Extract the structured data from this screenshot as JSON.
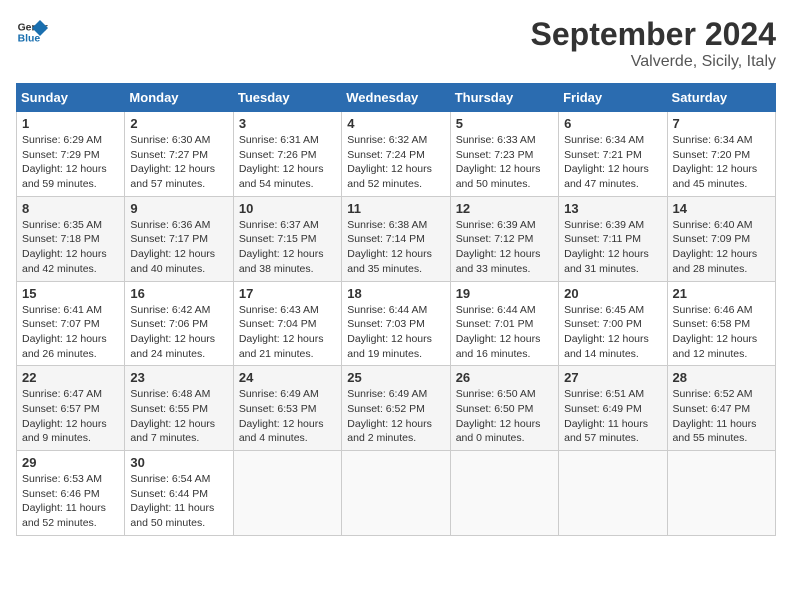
{
  "header": {
    "logo_line1": "General",
    "logo_line2": "Blue",
    "title": "September 2024",
    "subtitle": "Valverde, Sicily, Italy"
  },
  "weekdays": [
    "Sunday",
    "Monday",
    "Tuesday",
    "Wednesday",
    "Thursday",
    "Friday",
    "Saturday"
  ],
  "weeks": [
    [
      {
        "day": "1",
        "info": "Sunrise: 6:29 AM\nSunset: 7:29 PM\nDaylight: 12 hours\nand 59 minutes."
      },
      {
        "day": "2",
        "info": "Sunrise: 6:30 AM\nSunset: 7:27 PM\nDaylight: 12 hours\nand 57 minutes."
      },
      {
        "day": "3",
        "info": "Sunrise: 6:31 AM\nSunset: 7:26 PM\nDaylight: 12 hours\nand 54 minutes."
      },
      {
        "day": "4",
        "info": "Sunrise: 6:32 AM\nSunset: 7:24 PM\nDaylight: 12 hours\nand 52 minutes."
      },
      {
        "day": "5",
        "info": "Sunrise: 6:33 AM\nSunset: 7:23 PM\nDaylight: 12 hours\nand 50 minutes."
      },
      {
        "day": "6",
        "info": "Sunrise: 6:34 AM\nSunset: 7:21 PM\nDaylight: 12 hours\nand 47 minutes."
      },
      {
        "day": "7",
        "info": "Sunrise: 6:34 AM\nSunset: 7:20 PM\nDaylight: 12 hours\nand 45 minutes."
      }
    ],
    [
      {
        "day": "8",
        "info": "Sunrise: 6:35 AM\nSunset: 7:18 PM\nDaylight: 12 hours\nand 42 minutes."
      },
      {
        "day": "9",
        "info": "Sunrise: 6:36 AM\nSunset: 7:17 PM\nDaylight: 12 hours\nand 40 minutes."
      },
      {
        "day": "10",
        "info": "Sunrise: 6:37 AM\nSunset: 7:15 PM\nDaylight: 12 hours\nand 38 minutes."
      },
      {
        "day": "11",
        "info": "Sunrise: 6:38 AM\nSunset: 7:14 PM\nDaylight: 12 hours\nand 35 minutes."
      },
      {
        "day": "12",
        "info": "Sunrise: 6:39 AM\nSunset: 7:12 PM\nDaylight: 12 hours\nand 33 minutes."
      },
      {
        "day": "13",
        "info": "Sunrise: 6:39 AM\nSunset: 7:11 PM\nDaylight: 12 hours\nand 31 minutes."
      },
      {
        "day": "14",
        "info": "Sunrise: 6:40 AM\nSunset: 7:09 PM\nDaylight: 12 hours\nand 28 minutes."
      }
    ],
    [
      {
        "day": "15",
        "info": "Sunrise: 6:41 AM\nSunset: 7:07 PM\nDaylight: 12 hours\nand 26 minutes."
      },
      {
        "day": "16",
        "info": "Sunrise: 6:42 AM\nSunset: 7:06 PM\nDaylight: 12 hours\nand 24 minutes."
      },
      {
        "day": "17",
        "info": "Sunrise: 6:43 AM\nSunset: 7:04 PM\nDaylight: 12 hours\nand 21 minutes."
      },
      {
        "day": "18",
        "info": "Sunrise: 6:44 AM\nSunset: 7:03 PM\nDaylight: 12 hours\nand 19 minutes."
      },
      {
        "day": "19",
        "info": "Sunrise: 6:44 AM\nSunset: 7:01 PM\nDaylight: 12 hours\nand 16 minutes."
      },
      {
        "day": "20",
        "info": "Sunrise: 6:45 AM\nSunset: 7:00 PM\nDaylight: 12 hours\nand 14 minutes."
      },
      {
        "day": "21",
        "info": "Sunrise: 6:46 AM\nSunset: 6:58 PM\nDaylight: 12 hours\nand 12 minutes."
      }
    ],
    [
      {
        "day": "22",
        "info": "Sunrise: 6:47 AM\nSunset: 6:57 PM\nDaylight: 12 hours\nand 9 minutes."
      },
      {
        "day": "23",
        "info": "Sunrise: 6:48 AM\nSunset: 6:55 PM\nDaylight: 12 hours\nand 7 minutes."
      },
      {
        "day": "24",
        "info": "Sunrise: 6:49 AM\nSunset: 6:53 PM\nDaylight: 12 hours\nand 4 minutes."
      },
      {
        "day": "25",
        "info": "Sunrise: 6:49 AM\nSunset: 6:52 PM\nDaylight: 12 hours\nand 2 minutes."
      },
      {
        "day": "26",
        "info": "Sunrise: 6:50 AM\nSunset: 6:50 PM\nDaylight: 12 hours\nand 0 minutes."
      },
      {
        "day": "27",
        "info": "Sunrise: 6:51 AM\nSunset: 6:49 PM\nDaylight: 11 hours\nand 57 minutes."
      },
      {
        "day": "28",
        "info": "Sunrise: 6:52 AM\nSunset: 6:47 PM\nDaylight: 11 hours\nand 55 minutes."
      }
    ],
    [
      {
        "day": "29",
        "info": "Sunrise: 6:53 AM\nSunset: 6:46 PM\nDaylight: 11 hours\nand 52 minutes."
      },
      {
        "day": "30",
        "info": "Sunrise: 6:54 AM\nSunset: 6:44 PM\nDaylight: 11 hours\nand 50 minutes."
      },
      {
        "day": "",
        "info": ""
      },
      {
        "day": "",
        "info": ""
      },
      {
        "day": "",
        "info": ""
      },
      {
        "day": "",
        "info": ""
      },
      {
        "day": "",
        "info": ""
      }
    ]
  ]
}
